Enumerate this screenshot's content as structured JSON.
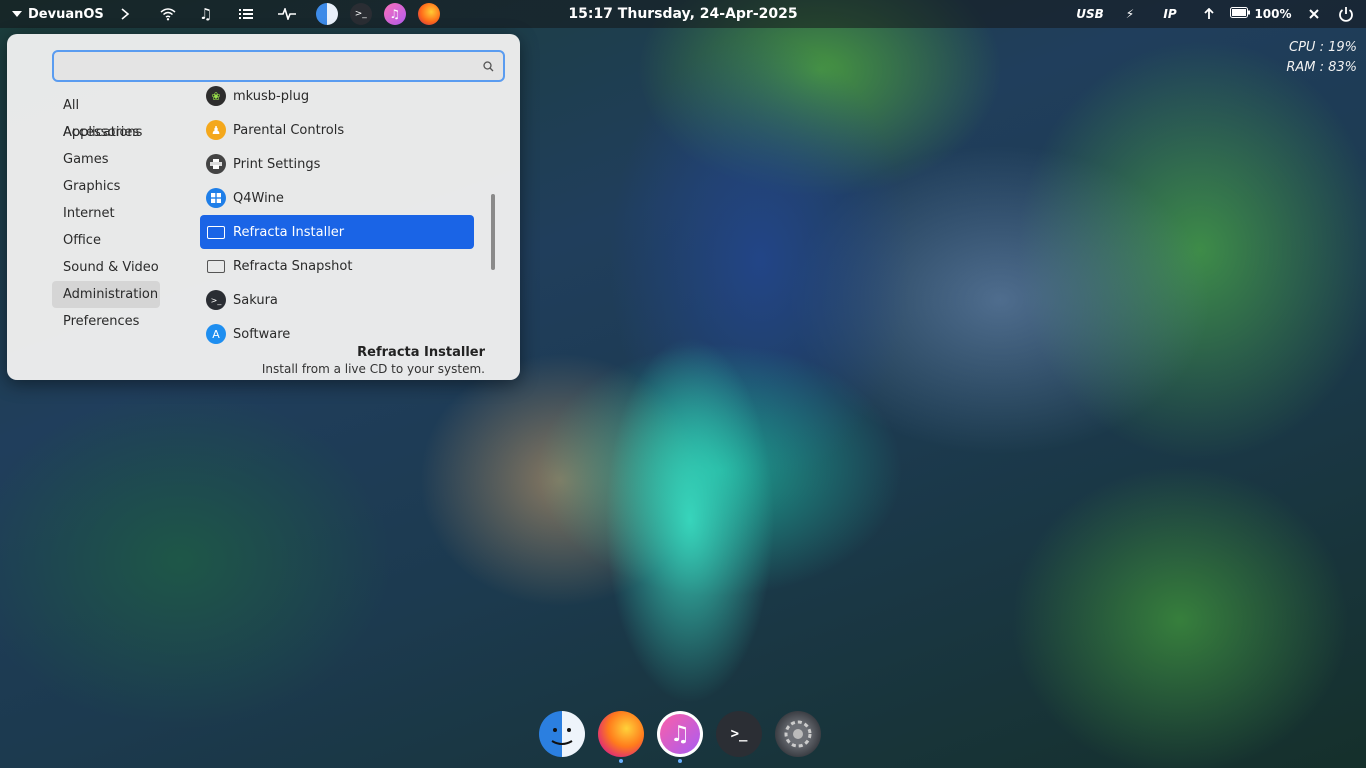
{
  "top_panel": {
    "menu_label": "DevuanOS",
    "clock": "15:17  Thursday, 24-Apr-2025",
    "tray": {
      "usb": "USB",
      "ip": "IP",
      "battery": "100%"
    }
  },
  "conky": {
    "cpu": "CPU : 19%",
    "ram": "RAM : 83%"
  },
  "menu": {
    "search_placeholder": "",
    "categories": [
      {
        "label": "All Applications"
      },
      {
        "label": "Accessories"
      },
      {
        "label": "Games"
      },
      {
        "label": "Graphics"
      },
      {
        "label": "Internet"
      },
      {
        "label": "Office"
      },
      {
        "label": "Sound & Video"
      },
      {
        "label": "Administration"
      },
      {
        "label": "Preferences"
      }
    ],
    "active_category": "Administration",
    "apps": [
      {
        "label": "mkusb-plug",
        "icon": "mkusb-icon"
      },
      {
        "label": "Parental Controls",
        "icon": "parental-controls-icon"
      },
      {
        "label": "Print Settings",
        "icon": "printer-icon"
      },
      {
        "label": "Q4Wine",
        "icon": "q4wine-icon"
      },
      {
        "label": "Refracta Installer",
        "icon": "monitor-icon"
      },
      {
        "label": "Refracta Snapshot",
        "icon": "monitor-icon"
      },
      {
        "label": "Sakura",
        "icon": "terminal-icon"
      },
      {
        "label": "Software",
        "icon": "app-store-icon"
      }
    ],
    "selected_app": "Refracta Installer",
    "description": {
      "title": "Refracta Installer",
      "text": "Install from a live CD to your system."
    }
  },
  "dock": {
    "items": [
      "finder-icon",
      "firefox-icon",
      "music-icon",
      "terminal-icon",
      "settings-icon"
    ]
  },
  "colors": {
    "accent": "#1a64e6",
    "search_border": "#5a9cf0"
  }
}
